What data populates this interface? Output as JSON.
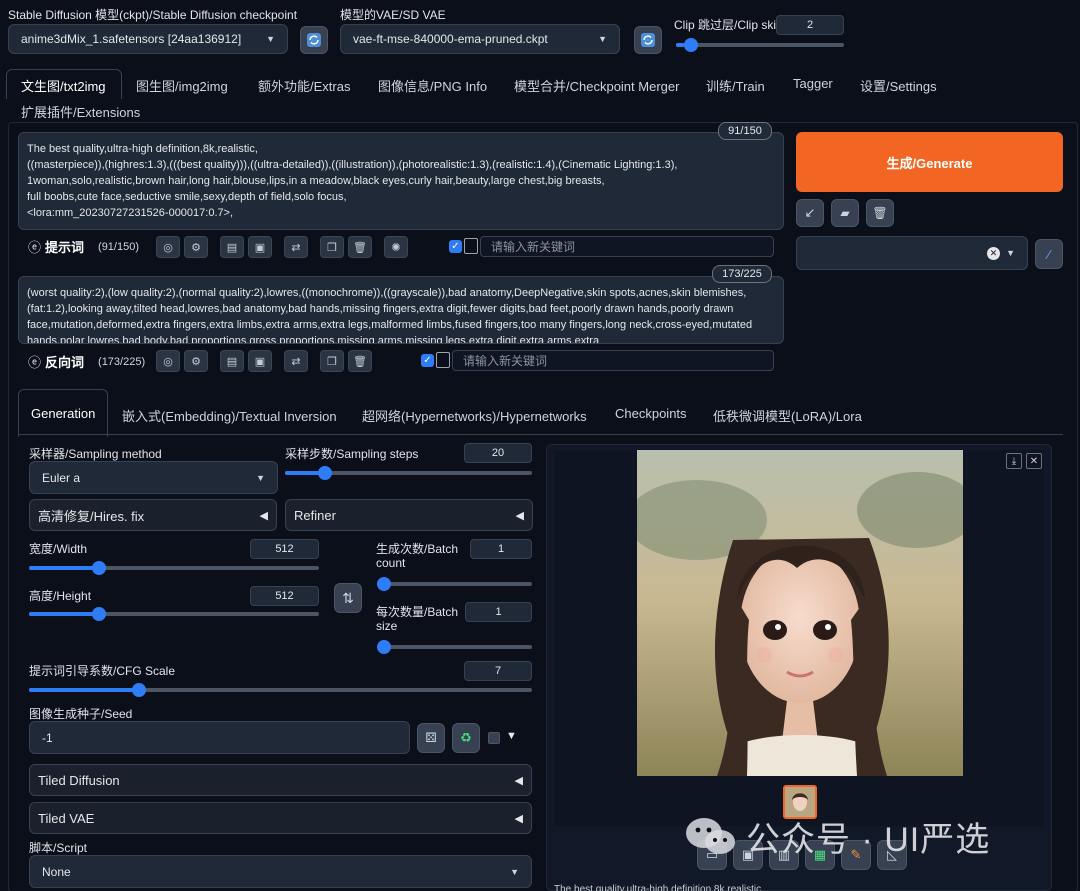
{
  "top": {
    "ckpt_label": "Stable Diffusion 模型(ckpt)/Stable Diffusion checkpoint",
    "ckpt_value": "anime3dMix_1.safetensors [24aa136912]",
    "vae_label": "模型的VAE/SD VAE",
    "vae_value": "vae-ft-mse-840000-ema-pruned.ckpt",
    "clip_label": "Clip 跳过层/Clip skip",
    "clip_value": "2",
    "clip_fraction": 0.05
  },
  "tabs": [
    "文生图/txt2img",
    "图生图/img2img",
    "额外功能/Extras",
    "图像信息/PNG Info",
    "模型合并/Checkpoint Merger",
    "训练/Train",
    "Tagger",
    "设置/Settings",
    "扩展插件/Extensions"
  ],
  "prompt": {
    "text": "The best quality,ultra-high definition,8k,realistic,\n((masterpiece)),(highres:1.3),(((best quality))),((ultra-detailed)),((illustration)),(photorealistic:1.3),(realistic:1.4),(Cinematic Lighting:1.3),\n1woman,solo,realistic,brown hair,long hair,blouse,lips,in a meadow,black eyes,curly hair,beauty,large chest,big breasts,\nfull boobs,cute face,seductive smile,sexy,depth of field,solo focus,\n<lora:mm_20230727231526-000017:0.7>,",
    "counter": "91/150",
    "label": "提示词",
    "count": "(91/150)",
    "kw_placeholder": "请输入新关键词"
  },
  "negative": {
    "text": "(worst quality:2),(low quality:2),(normal quality:2),lowres,((monochrome)),((grayscale)),bad anatomy,DeepNegative,skin spots,acnes,skin blemishes,(fat:1.2),looking away,tilted head,lowres,bad anatomy,bad hands,missing fingers,extra digit,fewer digits,bad feet,poorly drawn hands,poorly drawn face,mutation,deformed,extra fingers,extra limbs,extra arms,extra legs,malformed limbs,fused fingers,too many fingers,long neck,cross-eyed,mutated hands,polar lowres,bad body,bad proportions,gross proportions,missing arms,missing legs,extra digit,extra arms,extra",
    "counter": "173/225",
    "label": "反向词",
    "count": "(173/225)",
    "kw_placeholder": "请输入新关键词"
  },
  "generate_label": "生成/Generate",
  "subtabs": [
    "Generation",
    "嵌入式(Embedding)/Textual Inversion",
    "超网络(Hypernetworks)/Hypernetworks",
    "Checkpoints",
    "低秩微调模型(LoRA)/Lora"
  ],
  "params": {
    "sampler_label": "采样器/Sampling method",
    "sampler_value": "Euler a",
    "steps_label": "采样步数/Sampling steps",
    "steps_value": "20",
    "steps_fraction": 0.14,
    "hires_label": "高清修复/Hires. fix",
    "refiner_label": "Refiner",
    "width_label": "宽度/Width",
    "width_value": "512",
    "width_fraction": 0.23,
    "height_label": "高度/Height",
    "height_value": "512",
    "height_fraction": 0.23,
    "batch_count_label_1": "生成次数/Batch",
    "batch_count_label_2": "count",
    "batch_count_value": "1",
    "batch_count_fraction": 0.0,
    "batch_size_label_1": "每次数量/Batch",
    "batch_size_label_2": "size",
    "batch_size_value": "1",
    "batch_size_fraction": 0.0,
    "cfg_label": "提示词引导系数/CFG Scale",
    "cfg_value": "7",
    "cfg_fraction": 0.21,
    "seed_label": "图像生成种子/Seed",
    "seed_value": "-1",
    "tiled_diffusion_label": "Tiled Diffusion",
    "tiled_vae_label": "Tiled VAE",
    "script_label": "脚本/Script",
    "script_value": "None"
  },
  "watermark": "公众号 · UI严选",
  "output_caption": "The best quality,ultra-high definition,8k,realistic,",
  "colors": {
    "background": "#0b0f19",
    "accent": "#2f7df6",
    "generate": "#f26522"
  }
}
